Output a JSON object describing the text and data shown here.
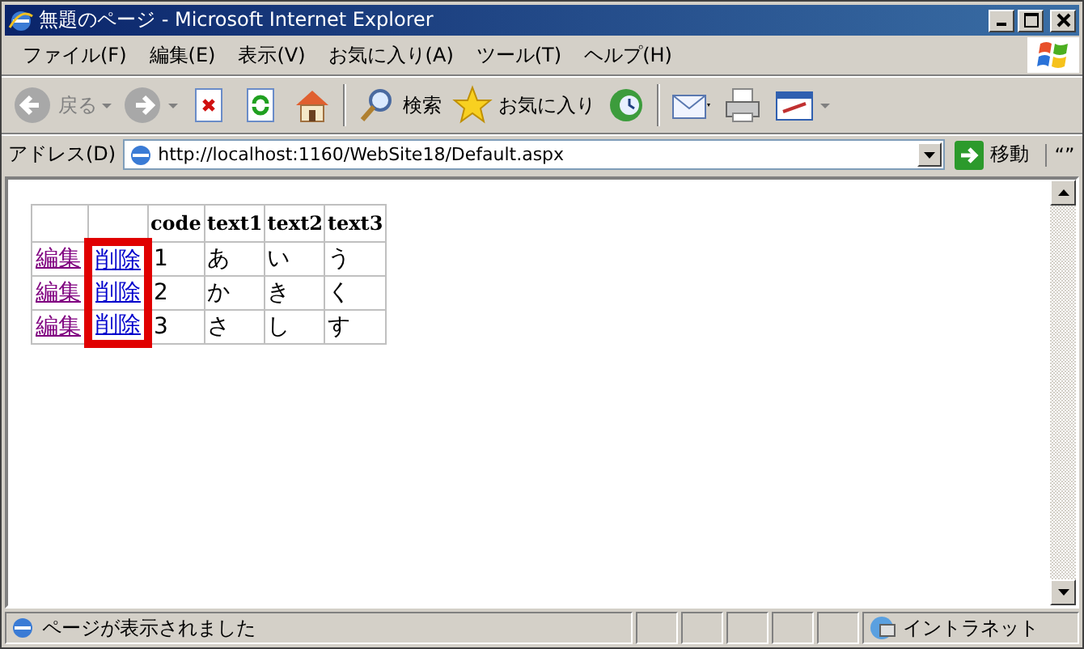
{
  "window": {
    "title": "無題のページ - Microsoft Internet Explorer"
  },
  "menu": [
    "ファイル(F)",
    "編集(E)",
    "表示(V)",
    "お気に入り(A)",
    "ツール(T)",
    "ヘルプ(H)"
  ],
  "toolbar": [
    {
      "kind": "back",
      "label": "戻る",
      "disabled": true
    },
    {
      "kind": "forward",
      "disabled": true
    },
    {
      "kind": "stop"
    },
    {
      "kind": "refresh"
    },
    {
      "kind": "home"
    },
    {
      "kind": "search",
      "label": "検索"
    },
    {
      "kind": "favorites",
      "label": "お気に入り"
    },
    {
      "kind": "history"
    },
    {
      "kind": "mail"
    },
    {
      "kind": "print"
    },
    {
      "kind": "edit"
    }
  ],
  "address": {
    "label": "アドレス(D)",
    "value": "http://localhost:1160/WebSite18/Default.aspx",
    "go": "移動",
    "links": "“”"
  },
  "table": {
    "delete_column_highlighted": true,
    "columns": [
      "code",
      "text1",
      "text2",
      "text3"
    ],
    "rows": [
      {
        "edit": {
          "label": "編集",
          "visited": true
        },
        "delete": {
          "label": "削除",
          "visited": false
        },
        "cells": [
          "1",
          "あ",
          "い",
          "う"
        ]
      },
      {
        "edit": {
          "label": "編集",
          "visited": true
        },
        "delete": {
          "label": "削除",
          "visited": false
        },
        "cells": [
          "2",
          "か",
          "き",
          "く"
        ]
      },
      {
        "edit": {
          "label": "編集",
          "visited": true
        },
        "delete": {
          "label": "削除",
          "visited": false
        },
        "cells": [
          "3",
          "さ",
          "し",
          "す"
        ]
      }
    ]
  },
  "status_bar": {
    "text": "ページが表示されました",
    "zone": "イントラネット"
  }
}
